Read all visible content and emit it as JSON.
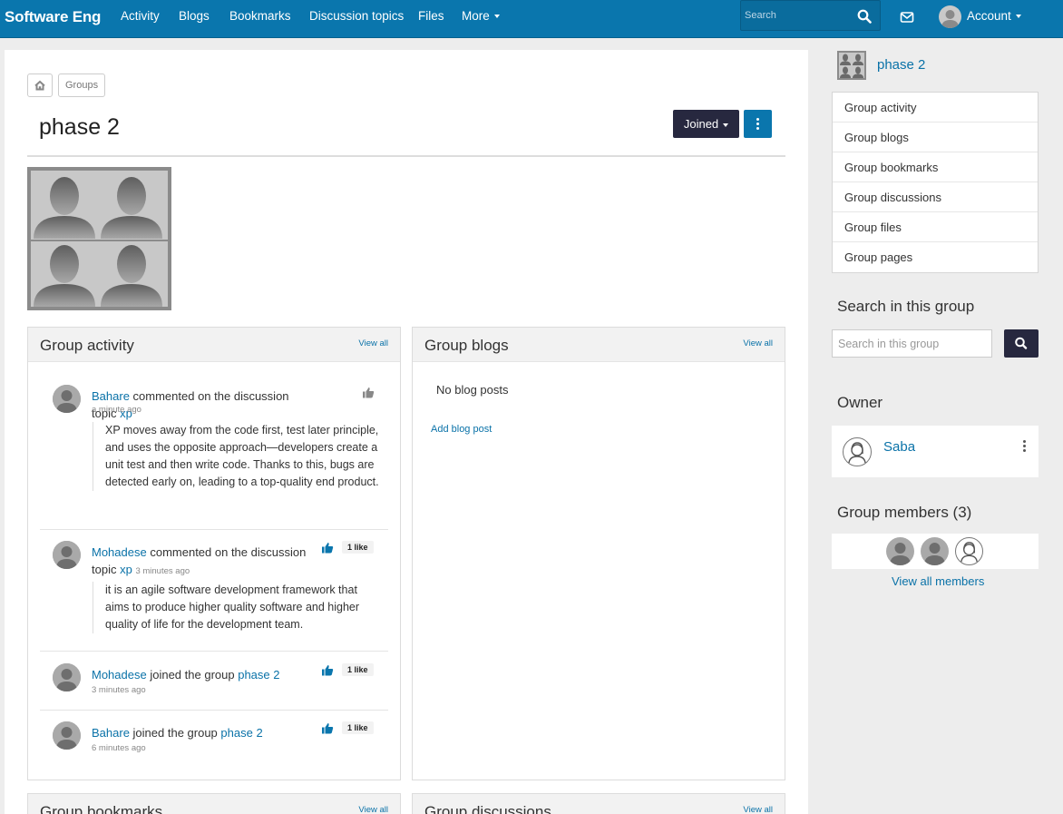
{
  "topbar": {
    "brand": "Software Eng",
    "nav": [
      {
        "label": "Activity"
      },
      {
        "label": "Blogs"
      },
      {
        "label": "Bookmarks"
      },
      {
        "label": "Discussion topics"
      },
      {
        "label": "Files"
      },
      {
        "label": "More"
      }
    ],
    "search_placeholder": "Search",
    "account_label": "Account"
  },
  "breadcrumb": {
    "groups_label": "Groups"
  },
  "page": {
    "title": "phase 2",
    "joined_label": "Joined"
  },
  "group_activity": {
    "title": "Group activity",
    "view_all": "View all",
    "items": [
      {
        "actor": "Bahare",
        "action": "commented on the discussion topic",
        "target": "xp",
        "time": "a minute ago",
        "body": "XP moves away from the code first, test later principle, and uses the opposite approach—developers create a unit test and then write code. Thanks to this, bugs are detected early on, leading to a top-quality end product.",
        "likes": ""
      },
      {
        "actor": "Mohadese",
        "action": "commented on the discussion topic",
        "target": "xp",
        "time": "3 minutes ago",
        "body": "it is an agile software development framework that aims to produce higher quality software and higher quality of life for the development team.",
        "likes": "1 like"
      },
      {
        "actor": "Mohadese",
        "action": "joined the group",
        "target": "phase 2",
        "time": "3 minutes ago",
        "body": "",
        "likes": "1 like"
      },
      {
        "actor": "Bahare",
        "action": "joined the group",
        "target": "phase 2",
        "time": "6 minutes ago",
        "body": "",
        "likes": "1 like"
      }
    ]
  },
  "group_blogs": {
    "title": "Group blogs",
    "view_all": "View all",
    "empty": "No blog posts",
    "add": "Add blog post"
  },
  "group_bookmarks": {
    "title": "Group bookmarks",
    "view_all": "View all"
  },
  "group_discussions": {
    "title": "Group discussions",
    "view_all": "View all"
  },
  "sidebar": {
    "group_name": "phase 2",
    "menu": [
      "Group activity",
      "Group blogs",
      "Group bookmarks",
      "Group discussions",
      "Group files",
      "Group pages"
    ],
    "search_heading": "Search in this group",
    "search_placeholder": "Search in this group",
    "owner_heading": "Owner",
    "owner_name": "Saba",
    "members_heading": "Group members (3)",
    "view_all_members": "View all members"
  },
  "colors": {
    "topbar": "#0a76ad",
    "dark_button": "#27283f",
    "link": "#0a72a8"
  }
}
